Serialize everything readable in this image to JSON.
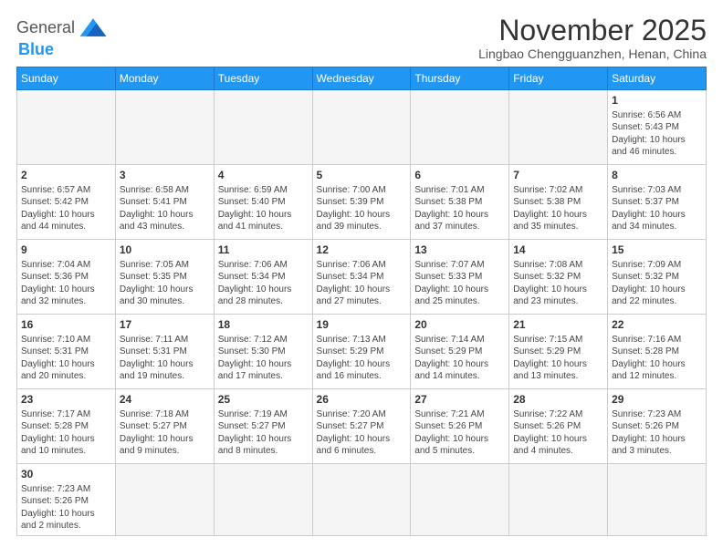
{
  "logo": {
    "text_general": "General",
    "text_blue": "Blue"
  },
  "header": {
    "month": "November 2025",
    "location": "Lingbao Chengguanzhen, Henan, China"
  },
  "weekdays": [
    "Sunday",
    "Monday",
    "Tuesday",
    "Wednesday",
    "Thursday",
    "Friday",
    "Saturday"
  ],
  "weeks": [
    [
      {
        "day": "",
        "info": "",
        "empty": true
      },
      {
        "day": "",
        "info": "",
        "empty": true
      },
      {
        "day": "",
        "info": "",
        "empty": true
      },
      {
        "day": "",
        "info": "",
        "empty": true
      },
      {
        "day": "",
        "info": "",
        "empty": true
      },
      {
        "day": "",
        "info": "",
        "empty": true
      },
      {
        "day": "1",
        "info": "Sunrise: 6:56 AM\nSunset: 5:43 PM\nDaylight: 10 hours\nand 46 minutes."
      }
    ],
    [
      {
        "day": "2",
        "info": "Sunrise: 6:57 AM\nSunset: 5:42 PM\nDaylight: 10 hours\nand 44 minutes."
      },
      {
        "day": "3",
        "info": "Sunrise: 6:58 AM\nSunset: 5:41 PM\nDaylight: 10 hours\nand 43 minutes."
      },
      {
        "day": "4",
        "info": "Sunrise: 6:59 AM\nSunset: 5:40 PM\nDaylight: 10 hours\nand 41 minutes."
      },
      {
        "day": "5",
        "info": "Sunrise: 7:00 AM\nSunset: 5:39 PM\nDaylight: 10 hours\nand 39 minutes."
      },
      {
        "day": "6",
        "info": "Sunrise: 7:01 AM\nSunset: 5:38 PM\nDaylight: 10 hours\nand 37 minutes."
      },
      {
        "day": "7",
        "info": "Sunrise: 7:02 AM\nSunset: 5:38 PM\nDaylight: 10 hours\nand 35 minutes."
      },
      {
        "day": "8",
        "info": "Sunrise: 7:03 AM\nSunset: 5:37 PM\nDaylight: 10 hours\nand 34 minutes."
      }
    ],
    [
      {
        "day": "9",
        "info": "Sunrise: 7:04 AM\nSunset: 5:36 PM\nDaylight: 10 hours\nand 32 minutes."
      },
      {
        "day": "10",
        "info": "Sunrise: 7:05 AM\nSunset: 5:35 PM\nDaylight: 10 hours\nand 30 minutes."
      },
      {
        "day": "11",
        "info": "Sunrise: 7:06 AM\nSunset: 5:34 PM\nDaylight: 10 hours\nand 28 minutes."
      },
      {
        "day": "12",
        "info": "Sunrise: 7:06 AM\nSunset: 5:34 PM\nDaylight: 10 hours\nand 27 minutes."
      },
      {
        "day": "13",
        "info": "Sunrise: 7:07 AM\nSunset: 5:33 PM\nDaylight: 10 hours\nand 25 minutes."
      },
      {
        "day": "14",
        "info": "Sunrise: 7:08 AM\nSunset: 5:32 PM\nDaylight: 10 hours\nand 23 minutes."
      },
      {
        "day": "15",
        "info": "Sunrise: 7:09 AM\nSunset: 5:32 PM\nDaylight: 10 hours\nand 22 minutes."
      }
    ],
    [
      {
        "day": "16",
        "info": "Sunrise: 7:10 AM\nSunset: 5:31 PM\nDaylight: 10 hours\nand 20 minutes."
      },
      {
        "day": "17",
        "info": "Sunrise: 7:11 AM\nSunset: 5:31 PM\nDaylight: 10 hours\nand 19 minutes."
      },
      {
        "day": "18",
        "info": "Sunrise: 7:12 AM\nSunset: 5:30 PM\nDaylight: 10 hours\nand 17 minutes."
      },
      {
        "day": "19",
        "info": "Sunrise: 7:13 AM\nSunset: 5:29 PM\nDaylight: 10 hours\nand 16 minutes."
      },
      {
        "day": "20",
        "info": "Sunrise: 7:14 AM\nSunset: 5:29 PM\nDaylight: 10 hours\nand 14 minutes."
      },
      {
        "day": "21",
        "info": "Sunrise: 7:15 AM\nSunset: 5:29 PM\nDaylight: 10 hours\nand 13 minutes."
      },
      {
        "day": "22",
        "info": "Sunrise: 7:16 AM\nSunset: 5:28 PM\nDaylight: 10 hours\nand 12 minutes."
      }
    ],
    [
      {
        "day": "23",
        "info": "Sunrise: 7:17 AM\nSunset: 5:28 PM\nDaylight: 10 hours\nand 10 minutes."
      },
      {
        "day": "24",
        "info": "Sunrise: 7:18 AM\nSunset: 5:27 PM\nDaylight: 10 hours\nand 9 minutes."
      },
      {
        "day": "25",
        "info": "Sunrise: 7:19 AM\nSunset: 5:27 PM\nDaylight: 10 hours\nand 8 minutes."
      },
      {
        "day": "26",
        "info": "Sunrise: 7:20 AM\nSunset: 5:27 PM\nDaylight: 10 hours\nand 6 minutes."
      },
      {
        "day": "27",
        "info": "Sunrise: 7:21 AM\nSunset: 5:26 PM\nDaylight: 10 hours\nand 5 minutes."
      },
      {
        "day": "28",
        "info": "Sunrise: 7:22 AM\nSunset: 5:26 PM\nDaylight: 10 hours\nand 4 minutes."
      },
      {
        "day": "29",
        "info": "Sunrise: 7:23 AM\nSunset: 5:26 PM\nDaylight: 10 hours\nand 3 minutes."
      }
    ],
    [
      {
        "day": "30",
        "info": "Sunrise: 7:23 AM\nSunset: 5:26 PM\nDaylight: 10 hours\nand 2 minutes.",
        "last": true
      },
      {
        "day": "",
        "info": "",
        "empty": true,
        "last": true
      },
      {
        "day": "",
        "info": "",
        "empty": true,
        "last": true
      },
      {
        "day": "",
        "info": "",
        "empty": true,
        "last": true
      },
      {
        "day": "",
        "info": "",
        "empty": true,
        "last": true
      },
      {
        "day": "",
        "info": "",
        "empty": true,
        "last": true
      },
      {
        "day": "",
        "info": "",
        "empty": true,
        "last": true
      }
    ]
  ]
}
